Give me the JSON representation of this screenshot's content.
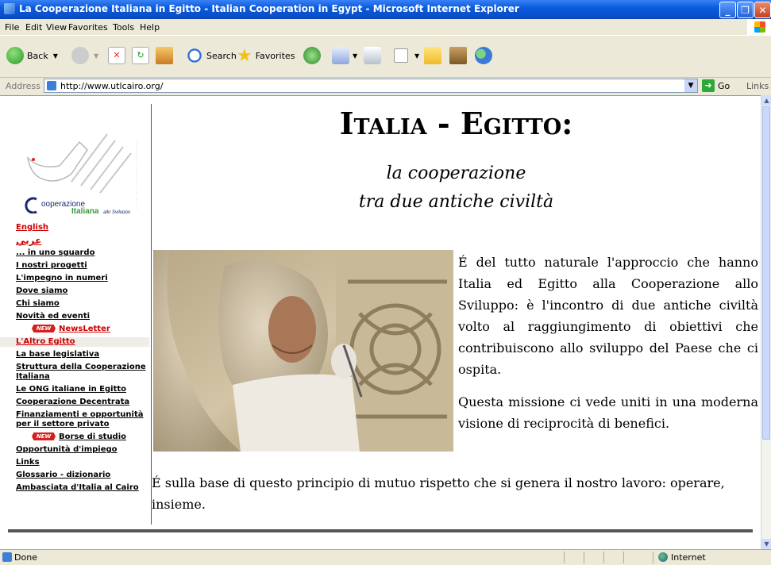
{
  "window": {
    "title": "La Cooperazione Italiana in Egitto - Italian Cooperation in Egypt - Microsoft Internet Explorer"
  },
  "menu": [
    "File",
    "Edit",
    "View",
    "Favorites",
    "Tools",
    "Help"
  ],
  "toolbar": {
    "back": "Back",
    "search": "Search",
    "favorites": "Favorites"
  },
  "address": {
    "label": "Address",
    "url": "http://www.utlcairo.org/",
    "go": "Go",
    "links": "Links"
  },
  "logo": {
    "text": "Cooperazione Italiana allo Sviluppo"
  },
  "nav": [
    "English",
    "عربي",
    "... in uno sguardo",
    "I nostri progetti",
    "L'impegno in numeri",
    "Dove siamo",
    "Chi siamo",
    "Novità ed eventi",
    "NewsLetter",
    "L'Altro Egitto",
    "La base legislativa",
    "Struttura della Cooperazione Italiana",
    "Le ONG italiane in Egitto",
    "Cooperazione Decentrata",
    "Finanziamenti e opportunità per il settore privato",
    "Borse di studio",
    "Opportunità d'impiego",
    "Links",
    "Glossario - dizionario",
    "Ambasciata d'Italia al Cairo"
  ],
  "badge": "NEW",
  "main": {
    "title": "Italia - Egitto:",
    "subtitle1": "la cooperazione",
    "subtitle2": "tra due antiche civiltà",
    "para1": "É del tutto naturale l'approccio che hanno Italia ed Egitto alla Cooperazione allo Sviluppo: è l'incontro di due antiche civiltà volto al raggiungimento di obiettivi che contribuiscono allo sviluppo del Paese che ci ospita.",
    "para2": "Questa missione ci vede uniti in una moderna visione di reciprocità di benefici.",
    "para3": "É sulla base di questo principio di mutuo rispetto che si genera il nostro lavoro: operare, insieme."
  },
  "status": {
    "text": "Done",
    "zone": "Internet"
  }
}
